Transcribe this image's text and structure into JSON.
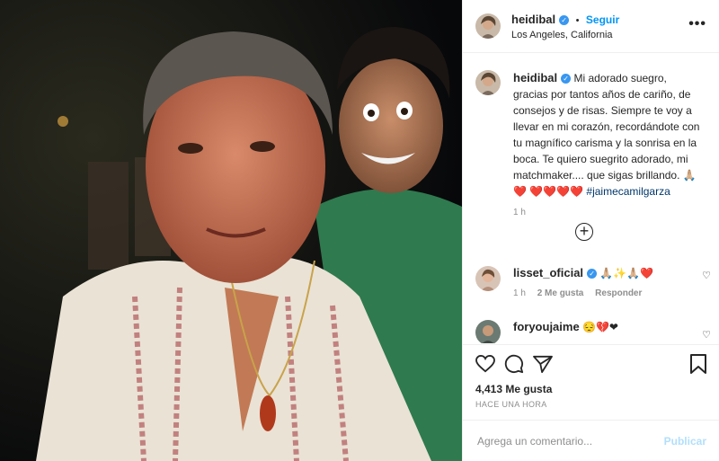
{
  "post": {
    "image_alt": "Two men posing at night, one in an embroidered white shirt, one grinning behind him",
    "author": {
      "username": "heidibal",
      "location": "Los Angeles, California",
      "follow_label": "Seguir",
      "verified_icon": "verified-badge-icon"
    },
    "more_icon": "more-options-icon",
    "caption": {
      "username": "heidibal",
      "text": "Mi adorado suegro, gracias por tantos años de cariño, de consejos y de risas. Siempre te voy a llevar en mi corazón, recordándote con tu magnífico carisma y la sonrisa en la boca. Te quiero suegrito adorado, mi matchmaker.... que sigas brillando. 🙏🏼❤️",
      "emojis": "❤️❤️❤️❤️",
      "hashtag": "#jaimecamilgarza",
      "time": "1 h"
    },
    "load_more_icon": "plus-circle-icon",
    "comments": [
      {
        "username": "lisset_oficial",
        "text": "🙏🏼✨🙏🏼❤️",
        "time": "1 h",
        "likes": "2 Me gusta",
        "reply": "Responder"
      },
      {
        "username": "foryoujaime",
        "text": "😔💔❤"
      }
    ],
    "actions": {
      "like_icon": "heart-icon",
      "comment_icon": "comment-icon",
      "share_icon": "share-icon",
      "save_icon": "bookmark-icon"
    },
    "likes_count": "4,413 Me gusta",
    "time_ago": "HACE UNA HORA",
    "add_comment": {
      "placeholder": "Agrega un comentario...",
      "publish_label": "Publicar"
    }
  },
  "colors": {
    "accent": "#0095f6",
    "verified": "#3897f0",
    "muted": "#8e8e8e"
  }
}
